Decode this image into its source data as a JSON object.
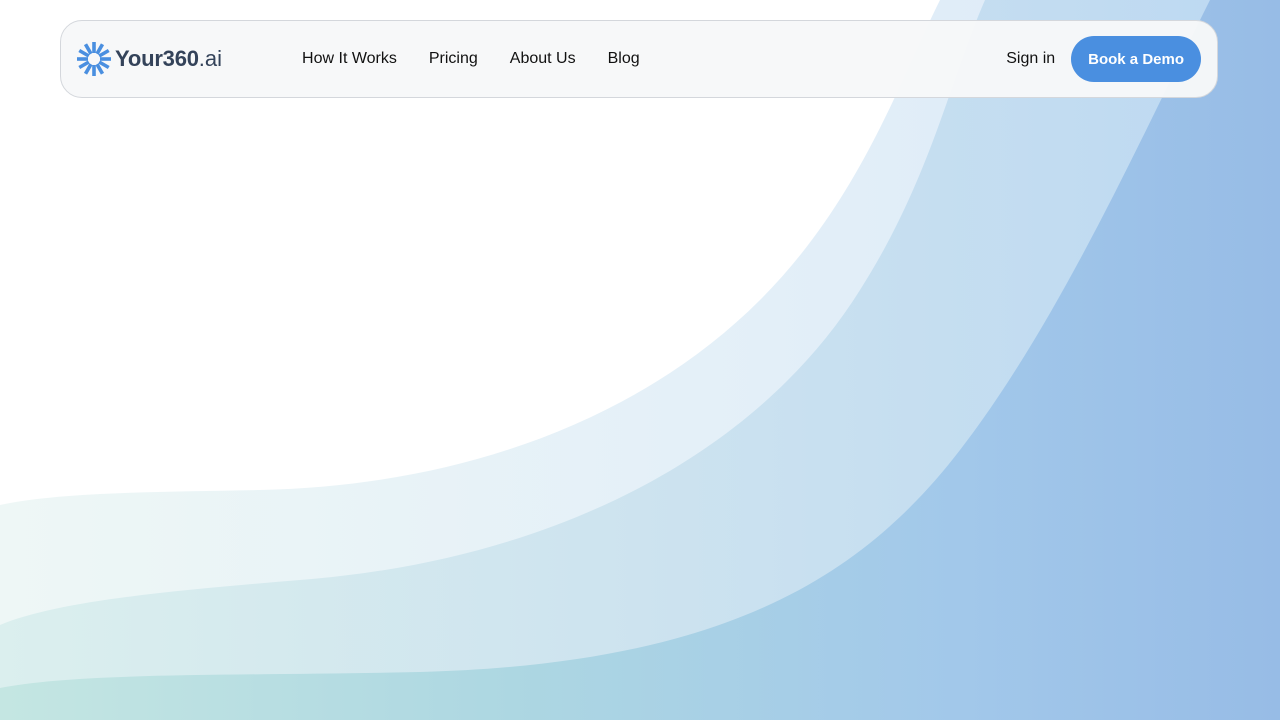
{
  "brand": {
    "name": "Your360",
    "suffix": ".ai",
    "logo_icon": "starburst-logo-icon",
    "logo_color": "#4a8fe0"
  },
  "nav": {
    "links": [
      "How It Works",
      "Pricing",
      "About Us",
      "Blog"
    ]
  },
  "actions": {
    "signin_label": "Sign in",
    "demo_label": "Book a Demo",
    "demo_color": "#4a8fe0"
  },
  "theme": {
    "wave_light": "#e4f0fa",
    "wave_mid": "#c2dbf2",
    "wave_deep": "#9dc0e9",
    "wave_teal": "#b7e2e2"
  }
}
